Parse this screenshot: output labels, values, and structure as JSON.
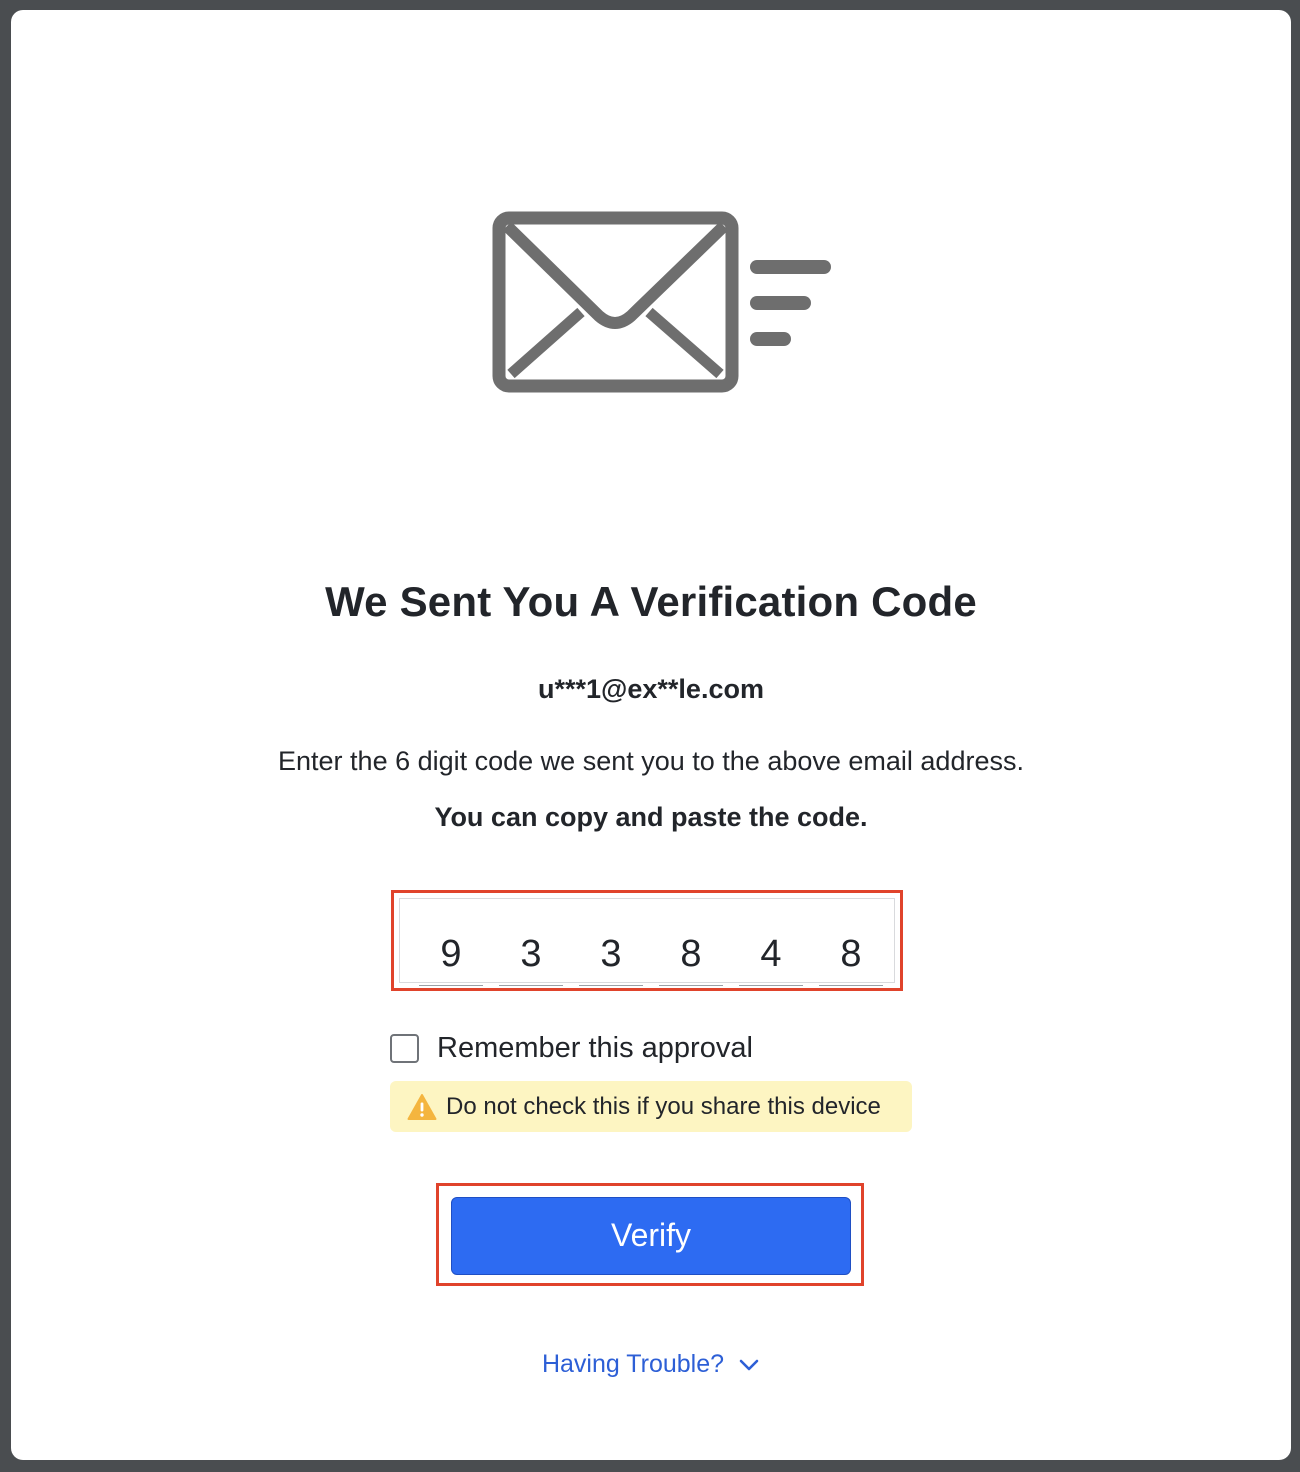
{
  "header": {
    "title": "We Sent You A Verification Code",
    "masked_email": "u***1@ex**le.com"
  },
  "body": {
    "instructions": "Enter the 6 digit code we sent you to the above email address.",
    "copy_hint": "You can copy and paste the code."
  },
  "code": {
    "digits": [
      "9",
      "3",
      "3",
      "8",
      "4",
      "8"
    ]
  },
  "remember": {
    "label": "Remember this approval",
    "checked": false
  },
  "warning": {
    "icon": "warning-triangle-icon",
    "text": "Do not check this if you share this device"
  },
  "actions": {
    "verify_label": "Verify",
    "trouble_label": "Having Trouble?"
  },
  "icons": {
    "hero": "email-sent-icon",
    "trouble": "chevron-down-icon"
  },
  "colors": {
    "primary": "#2d6bf2",
    "link": "#2d5fd6",
    "highlight": "#e0432b",
    "warning_bg": "#fdf5c2",
    "warning_icon": "#f4b53f",
    "icon_gray": "#6e6e6e"
  }
}
